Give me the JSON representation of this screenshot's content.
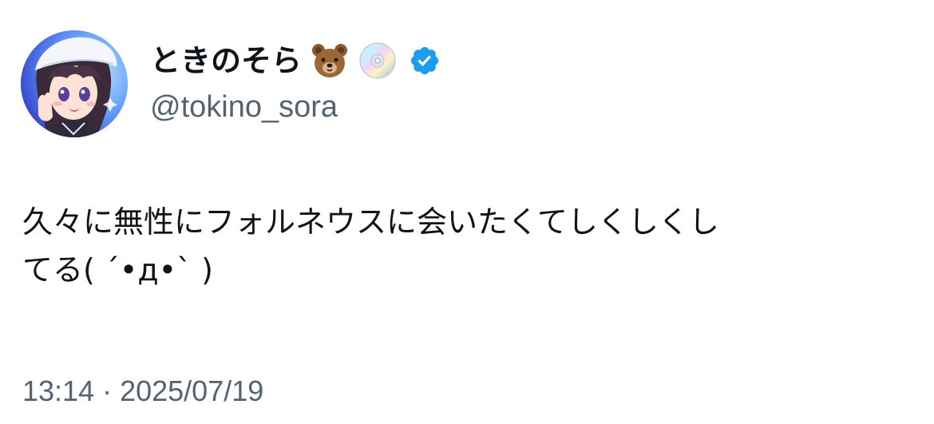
{
  "author": {
    "display_name": "ときのそら",
    "name_emojis": [
      "bear-face-emoji",
      "optical-disc-emoji"
    ],
    "verified": true,
    "handle": "@tokino_sora"
  },
  "tweet": {
    "text_lines": [
      "久々に無性にフォルネウスに会いたくてしくしくし",
      "てる( ´•д•` )"
    ]
  },
  "meta": {
    "time": "13:14",
    "separator": " · ",
    "date": "2025/07/19"
  },
  "colors": {
    "verified_badge": "#1d9bf0",
    "secondary_text": "#536471",
    "primary_text": "#0f1419"
  }
}
